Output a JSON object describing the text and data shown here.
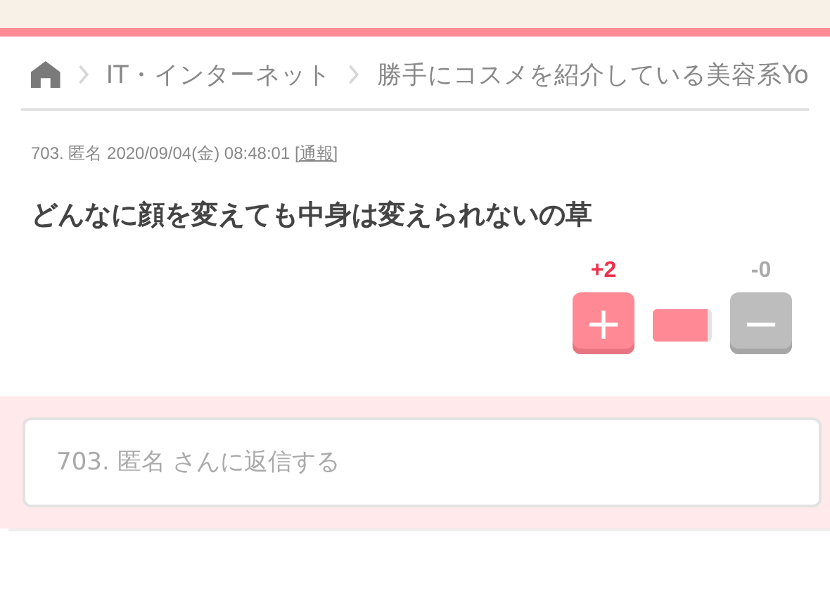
{
  "breadcrumb": [
    "IT・インターネット",
    "勝手にコスメを紹介している美容系Yo"
  ],
  "post": {
    "meta": "703. 匿名 2020/09/04(金) 08:48:01",
    "report": "[通報]",
    "body": "どんなに顔を変えても中身は変えられないの草"
  },
  "votes": {
    "plus_count": "+2",
    "plus": "+",
    "minus_count": "-0",
    "minus": "−"
  },
  "reply": {
    "placeholder": "703. 匿名 さんに返信する"
  }
}
